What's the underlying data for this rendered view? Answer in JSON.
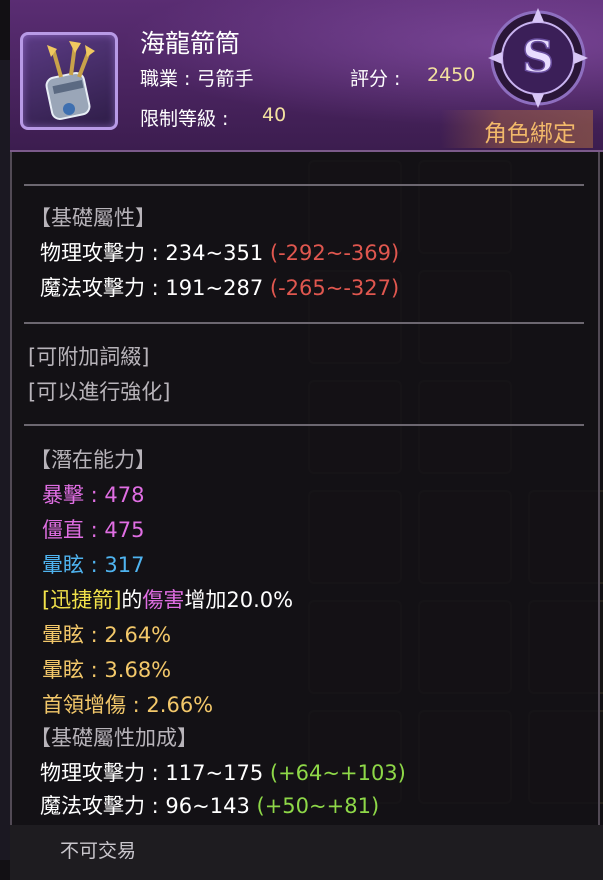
{
  "item": {
    "name": "海龍箭筒",
    "job_label": "職業 : 弓箭手",
    "score_label": "評分 :",
    "score_value": "2450",
    "level_label": "限制等級 :",
    "level_value": "40",
    "grade": "S",
    "binding": "角色綁定",
    "icon": "quiver-icon",
    "grade_icon": "s-grade-emblem-icon"
  },
  "basic": {
    "header": "【基礎屬性】",
    "physical_label": "物理攻擊力 : 234~351",
    "physical_diff": "(-292~-369)",
    "magic_label": "魔法攻擊力 : 191~287",
    "magic_diff": "(-265~-327)"
  },
  "extras": {
    "affix": "[可附加詞綴]",
    "enhance": "[可以進行強化]"
  },
  "potential": {
    "header": "【潛在能力】",
    "crit": "暴擊 : 478",
    "stiff": "僵直 : 475",
    "stun": "暈眩 : 317",
    "skill_name": "[迅捷箭]",
    "skill_of": "的",
    "skill_damage": "傷害",
    "skill_increase": "增加20.0%",
    "stun_pct_1": "暈眩 : 2.64%",
    "stun_pct_2": "暈眩 : 3.68%",
    "boss_damage": "首領增傷 : 2.66%"
  },
  "bonus": {
    "header": "【基礎屬性加成】",
    "physical_label": "物理攻擊力 : 117~175",
    "physical_diff": "(+64~+103)",
    "magic_label": "魔法攻擊力 : 96~143",
    "magic_diff": "(+50~+81)"
  },
  "footer": {
    "trade": "不可交易"
  },
  "colors": {
    "header_purple": "#4a2460",
    "stat_red": "#e0574f",
    "stat_green": "#8ed848",
    "potential_magenta": "#e06ee3",
    "potential_blue": "#4fb4f0",
    "potential_orange": "#f3c86a",
    "skill_yellow": "#f2e24a",
    "bind_orange": "#f2b96a"
  }
}
